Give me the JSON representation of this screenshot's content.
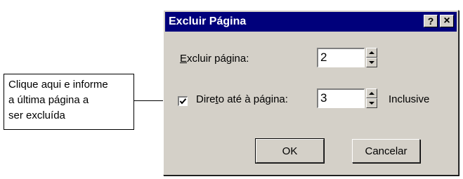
{
  "callout": {
    "lines": [
      "Clique aqui e informe",
      "a última página  a",
      "ser excluída"
    ]
  },
  "dialog": {
    "title": "Excluir Página",
    "help_button": "?",
    "close_button": "×",
    "delete_page": {
      "label_mnemonic": "E",
      "label_rest": "xcluir página:",
      "value": "2"
    },
    "direct_to_page": {
      "checked": true,
      "label_before": "Dire",
      "label_mnemonic": "t",
      "label_after": "o até à página:",
      "value": "3",
      "suffix": "Inclusive"
    },
    "ok_label": "OK",
    "cancel_label": "Cancelar"
  }
}
